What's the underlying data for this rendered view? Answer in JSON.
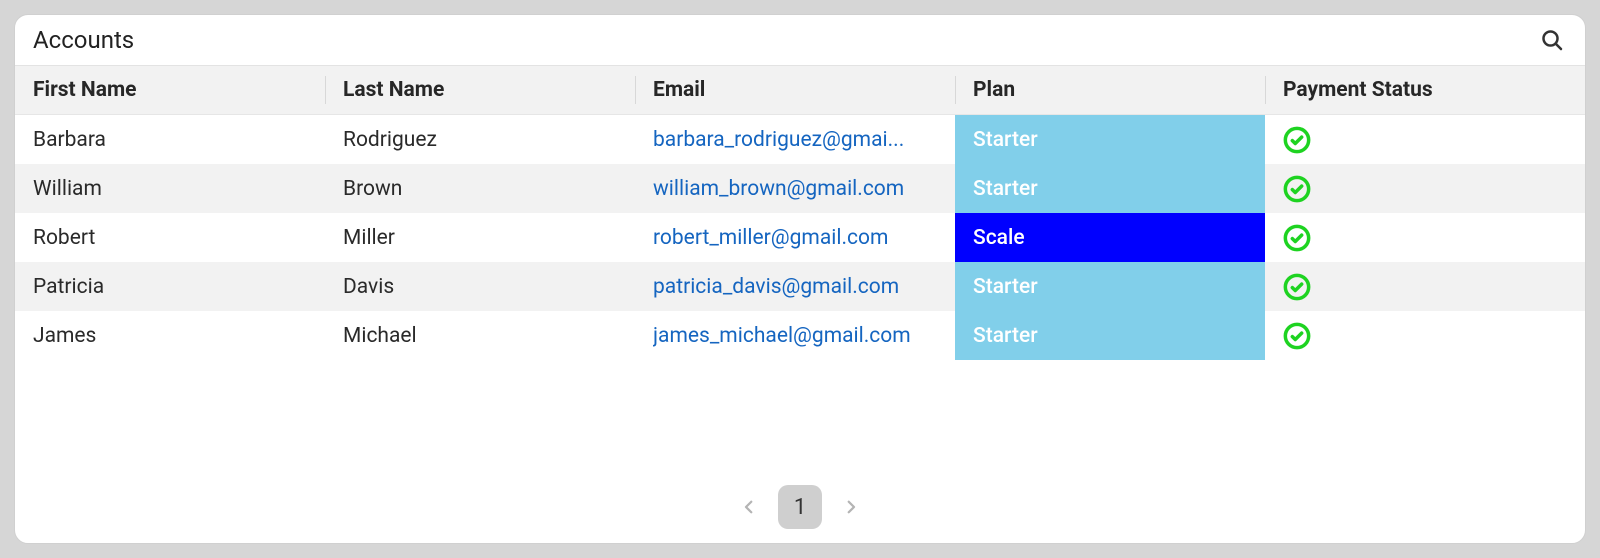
{
  "header": {
    "title": "Accounts"
  },
  "columns": {
    "first_name": "First Name",
    "last_name": "Last Name",
    "email": "Email",
    "plan": "Plan",
    "payment_status": "Payment Status"
  },
  "rows": [
    {
      "first_name": "Barbara",
      "last_name": "Rodriguez",
      "email": "barbara_rodriguez@gmai...",
      "plan": "Starter",
      "payment_ok": true
    },
    {
      "first_name": "William",
      "last_name": "Brown",
      "email": "william_brown@gmail.com",
      "plan": "Starter",
      "payment_ok": true
    },
    {
      "first_name": "Robert",
      "last_name": "Miller",
      "email": "robert_miller@gmail.com",
      "plan": "Scale",
      "payment_ok": true
    },
    {
      "first_name": "Patricia",
      "last_name": "Davis",
      "email": "patricia_davis@gmail.com",
      "plan": "Starter",
      "payment_ok": true
    },
    {
      "first_name": "James",
      "last_name": "Michael",
      "email": "james_michael@gmail.com",
      "plan": "Starter",
      "payment_ok": true
    }
  ],
  "pagination": {
    "current_page": "1"
  },
  "colors": {
    "plan_starter": "#81cfea",
    "plan_scale": "#0000ff",
    "status_ok": "#1ed321",
    "link": "#1565c0"
  }
}
